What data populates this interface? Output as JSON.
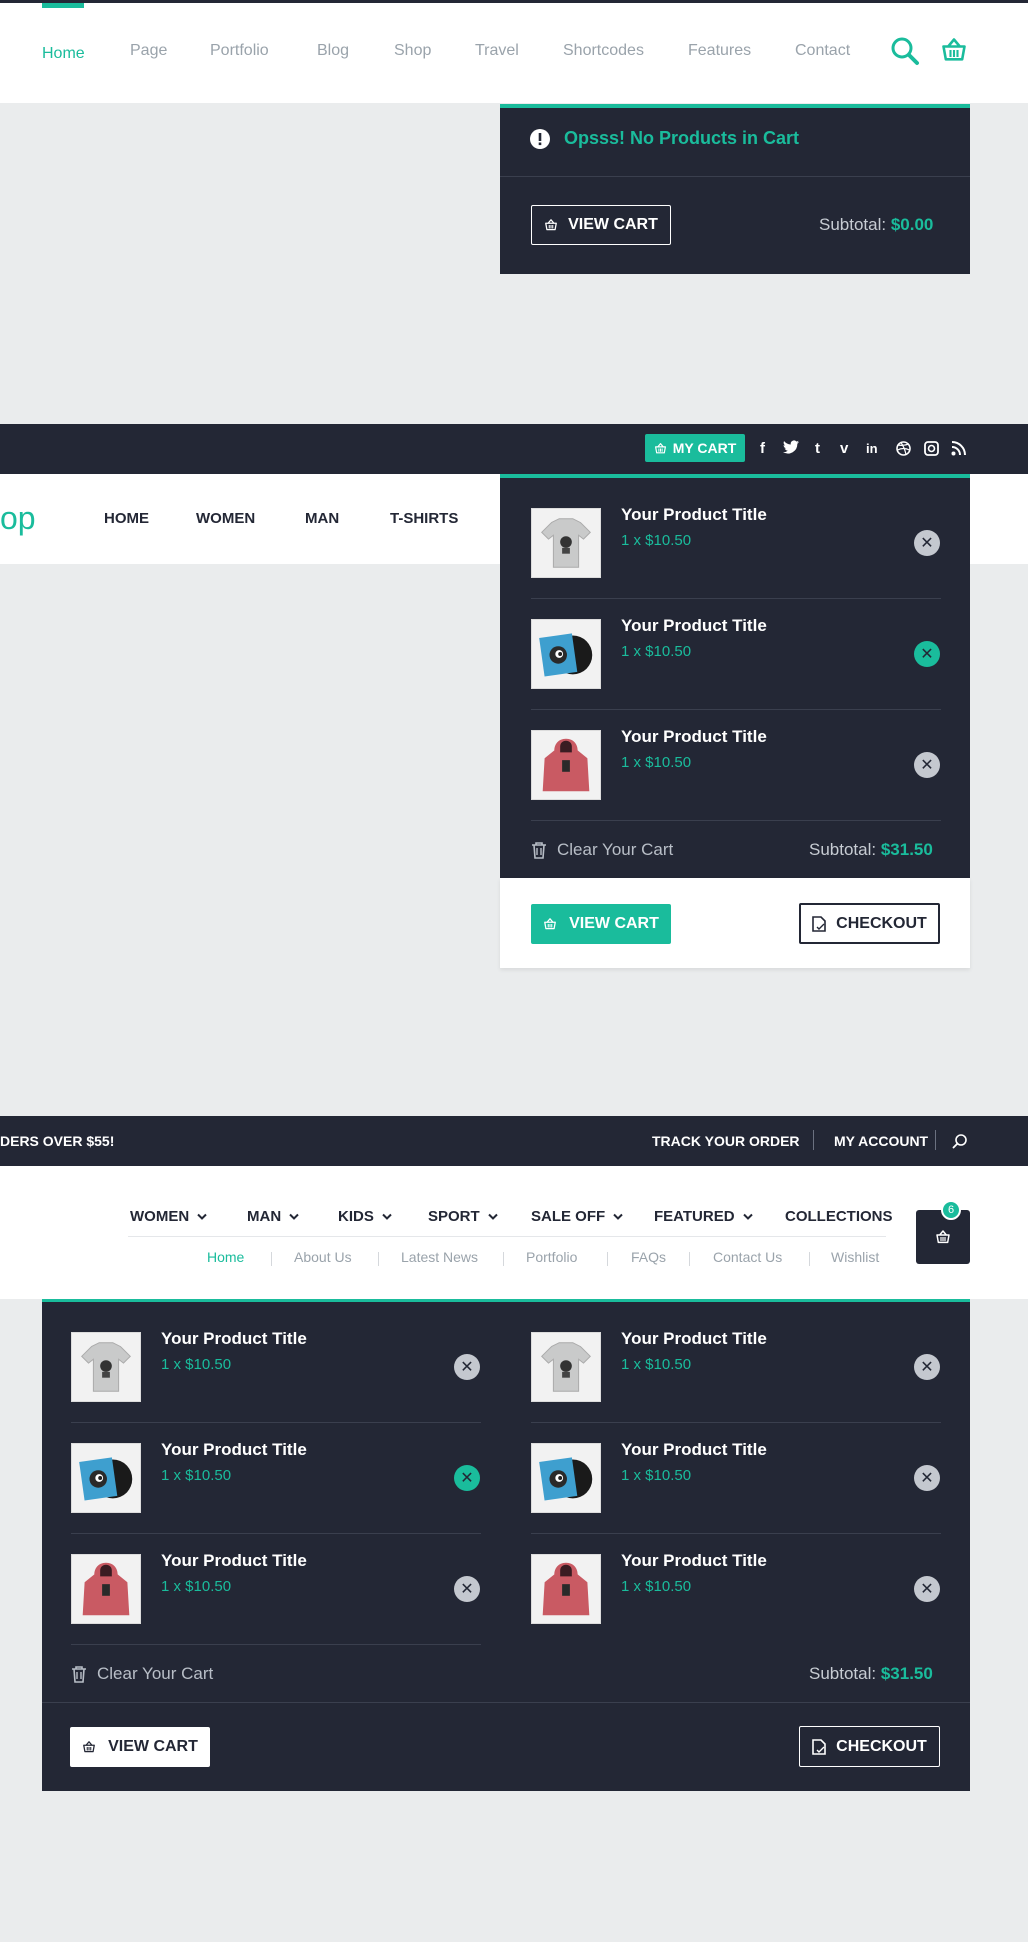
{
  "section1": {
    "nav": [
      "Home",
      "Page",
      "Portfolio",
      "Blog",
      "Shop",
      "Travel",
      "Shortcodes",
      "Features",
      "Contact"
    ],
    "empty_message": "Opsss! No Products in Cart",
    "view_cart": "VIEW CART",
    "subtotal_label": "Subtotal:",
    "subtotal_value": "$0.00"
  },
  "section2": {
    "my_cart": "MY CART",
    "social_icons": [
      "facebook-icon",
      "twitter-icon",
      "tumblr-icon",
      "vimeo-icon",
      "linkedin-icon",
      "dribbble-icon",
      "instagram-icon",
      "rss-icon"
    ],
    "logo_fragment": "op",
    "nav": [
      "HOME",
      "WOMEN",
      "MAN",
      "T-SHIRTS"
    ],
    "items": [
      {
        "title": "Your Product Title",
        "price": "1 x $10.50",
        "thumb": "tshirt"
      },
      {
        "title": "Your Product Title",
        "price": "1 x $10.50",
        "thumb": "vinyl"
      },
      {
        "title": "Your Product Title",
        "price": "1 x $10.50",
        "thumb": "hoodie"
      }
    ],
    "clear_cart": "Clear Your Cart",
    "subtotal_label": "Subtotal:",
    "subtotal_value": "$31.50",
    "view_cart": "VIEW CART",
    "checkout": "CHECKOUT"
  },
  "section3": {
    "promo": "DERS OVER $55!",
    "track_order": "TRACK YOUR ORDER",
    "my_account": "MY ACCOUNT",
    "main_nav": [
      "WOMEN",
      "MAN",
      "KIDS",
      "SPORT",
      "SALE OFF",
      "FEATURED",
      "COLLECTIONS"
    ],
    "sub_nav": [
      "Home",
      "About Us",
      "Latest News",
      "Portfolio",
      "FAQs",
      "Contact Us",
      "Wishlist"
    ],
    "cart_count": "6",
    "items_left": [
      {
        "title": "Your Product Title",
        "price": "1 x $10.50"
      },
      {
        "title": "Your Product Title",
        "price": "1 x $10.50"
      },
      {
        "title": "Your Product Title",
        "price": "1 x $10.50"
      }
    ],
    "items_right": [
      {
        "title": "Your Product Title",
        "price": "1 x $10.50"
      },
      {
        "title": "Your Product Title",
        "price": "1 x $10.50"
      },
      {
        "title": "Your Product Title",
        "price": "1 x $10.50"
      }
    ],
    "clear_cart": "Clear Your Cart",
    "subtotal_label": "Subtotal:",
    "subtotal_value": "$31.50",
    "view_cart": "VIEW CART",
    "checkout": "CHECKOUT"
  }
}
